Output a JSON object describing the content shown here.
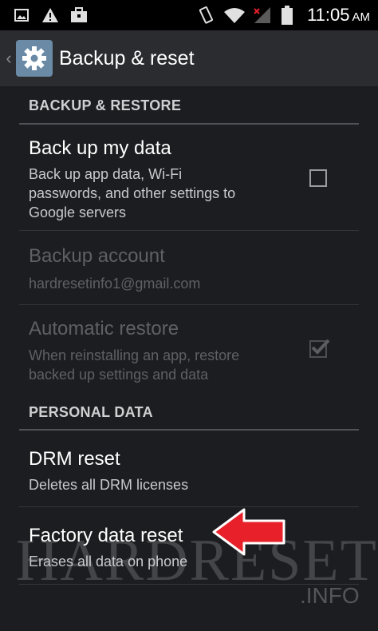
{
  "status_bar": {
    "time": "11:05",
    "ampm": "AM",
    "icons": [
      "image-icon",
      "warning-icon",
      "briefcase-icon",
      "vibrate-icon",
      "wifi-icon",
      "signal-icon",
      "battery-icon"
    ]
  },
  "action_bar": {
    "title": "Backup & reset",
    "icon": "gear-icon"
  },
  "sections": {
    "backup": {
      "header": "BACKUP & RESTORE",
      "items": [
        {
          "title": "Back up my data",
          "summary": "Back up app data, Wi-Fi\npasswords, and other settings to\nGoogle servers",
          "checked": false,
          "enabled": true
        },
        {
          "title": "Backup account",
          "summary": "hardresetinfo1@gmail.com",
          "enabled": false
        },
        {
          "title": "Automatic restore",
          "summary": "When reinstalling an app, restore\nbacked up settings and data",
          "checked": true,
          "enabled": false
        }
      ]
    },
    "personal": {
      "header": "PERSONAL DATA",
      "items": [
        {
          "title": "DRM reset",
          "summary": "Deletes all DRM licenses",
          "enabled": true
        },
        {
          "title": "Factory data reset",
          "summary": "Erases all data on phone",
          "enabled": true
        }
      ]
    }
  },
  "watermark": {
    "text": "HARDRESET",
    "sub": ".INFO"
  },
  "colors": {
    "background": "#1c1d20",
    "action_bar": "#2b2c30",
    "status_bar": "#000000",
    "arrow": "#e8202a",
    "gear_box": "#6a8aa5"
  }
}
